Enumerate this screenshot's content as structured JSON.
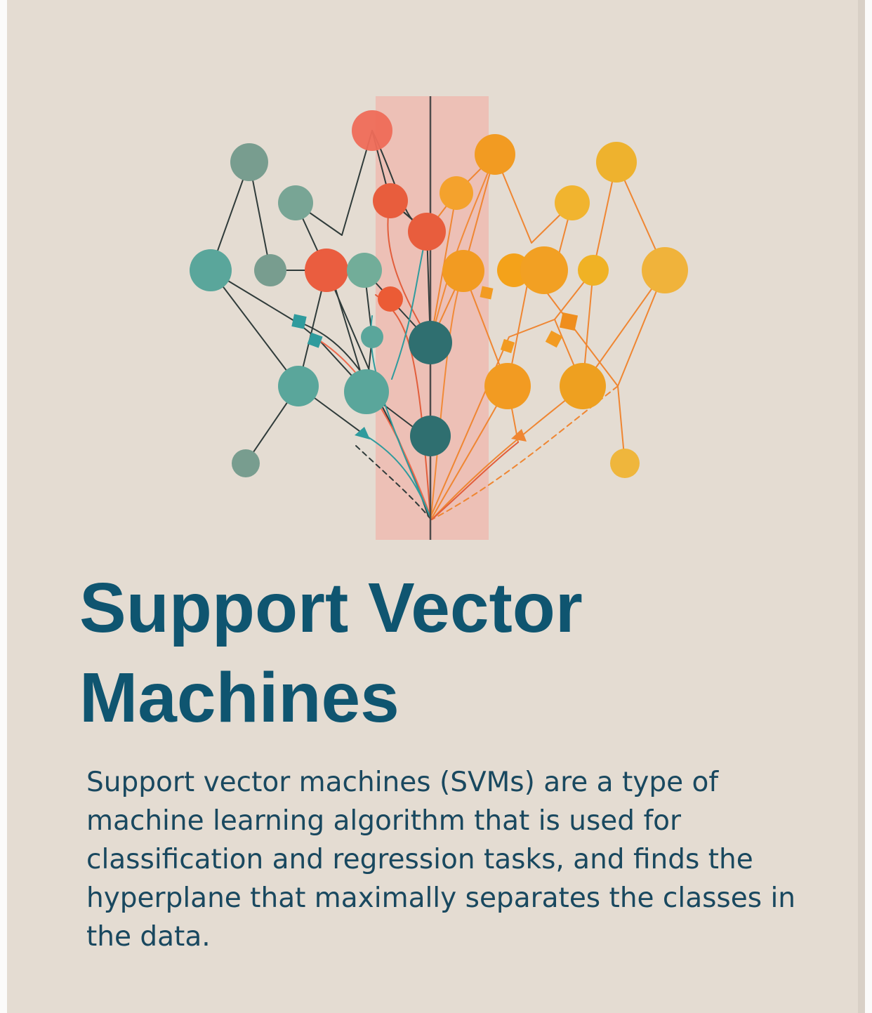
{
  "title": "Support Vector Machines",
  "description": "Support vector machines (SVMs) are a type of machine learning algorithm that is used for classification and regression tasks, and finds the hyperplane that maximally separates the classes in the data.",
  "colors": {
    "background": "#e4dcd2",
    "title_text": "#0f5570",
    "body_text": "#19485f",
    "margin_band": "#efb8ae",
    "hyperplane": "#4e4b4b",
    "teal_node": "#5aa69b",
    "gray_green_node": "#789d8f",
    "dark_teal_node": "#2f6f70",
    "coral_node": "#ea5d3f",
    "orange_node": "#f29b22",
    "yellow_node": "#eeb22e"
  }
}
